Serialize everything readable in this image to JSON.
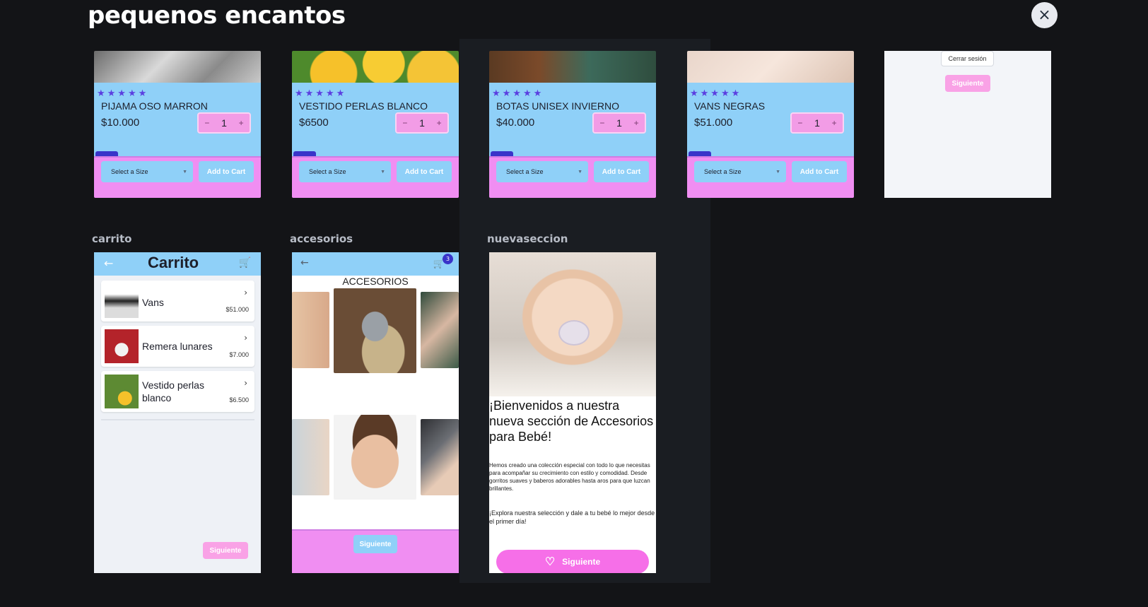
{
  "page": {
    "title": "pequenos encantos",
    "close_icon": "×"
  },
  "products": [
    {
      "name": "PIJAMA OSO MARRON",
      "price": "$10.000",
      "qty": "1",
      "stars": "★★★★★",
      "minus": "−",
      "plus": "+",
      "size_placeholder": "Select a Size",
      "add_to_cart": "Add to Cart"
    },
    {
      "name": "VESTIDO PERLAS BLANCO",
      "price": "$6500",
      "qty": "1",
      "stars": "★★★★★",
      "minus": "−",
      "plus": "+",
      "size_placeholder": "Select a Size",
      "add_to_cart": "Add to Cart"
    },
    {
      "name": "BOTAS UNISEX INVIERNO",
      "price": "$40.000",
      "qty": "1",
      "stars": "★★★★★",
      "minus": "−",
      "plus": "+",
      "size_placeholder": "Select a Size",
      "add_to_cart": "Add to Cart"
    },
    {
      "name": "VANS NEGRAS",
      "price": "$51.000",
      "qty": "1",
      "stars": "★★★★★",
      "minus": "−",
      "plus": "+",
      "size_placeholder": "Select a Size",
      "add_to_cart": "Add to Cart"
    }
  ],
  "login_fragment": {
    "logout_label": "Cerrar sesión",
    "next_label": "Siguiente"
  },
  "sections": {
    "cart": "carrito",
    "accessories": "accesorios",
    "new_section": "nuevaseccion"
  },
  "cart_screen": {
    "title": "Carrito",
    "back_icon": "←",
    "cart_icon": "🛒",
    "items": [
      {
        "name": "Vans",
        "price": "$51.000",
        "arrow": "›"
      },
      {
        "name": "Remera lunares",
        "price": "$7.000",
        "arrow": "›"
      },
      {
        "name": "Vestido perlas blanco",
        "price": "$6.500",
        "arrow": "›"
      }
    ],
    "next_label": "Siguiente"
  },
  "accessories_screen": {
    "heading": "ACCESORIOS",
    "back_icon": "←",
    "cart_icon": "🛒",
    "badge": "3",
    "next_label": "Siguiente"
  },
  "new_section_screen": {
    "heading": "¡Bienvenidos a nuestra nueva sección de Accesorios para Bebé!",
    "paragraph1": "Hemos creado una colección especial con todo lo que necesitas para acompañar su crecimiento con estilo y comodidad. Desde gorritos suaves y baberos adorables hasta aros para que luzcan brillantes.",
    "paragraph2": "¡Explora nuestra selección y dale a tu bebé lo mejor desde el primer día!",
    "heart_icon": "♡",
    "next_label": "Siguiente"
  },
  "colors": {
    "accent_blue": "#8fd0f8",
    "accent_pink": "#f08ef2",
    "star_purple": "#5b3fe0",
    "background": "#131417"
  }
}
